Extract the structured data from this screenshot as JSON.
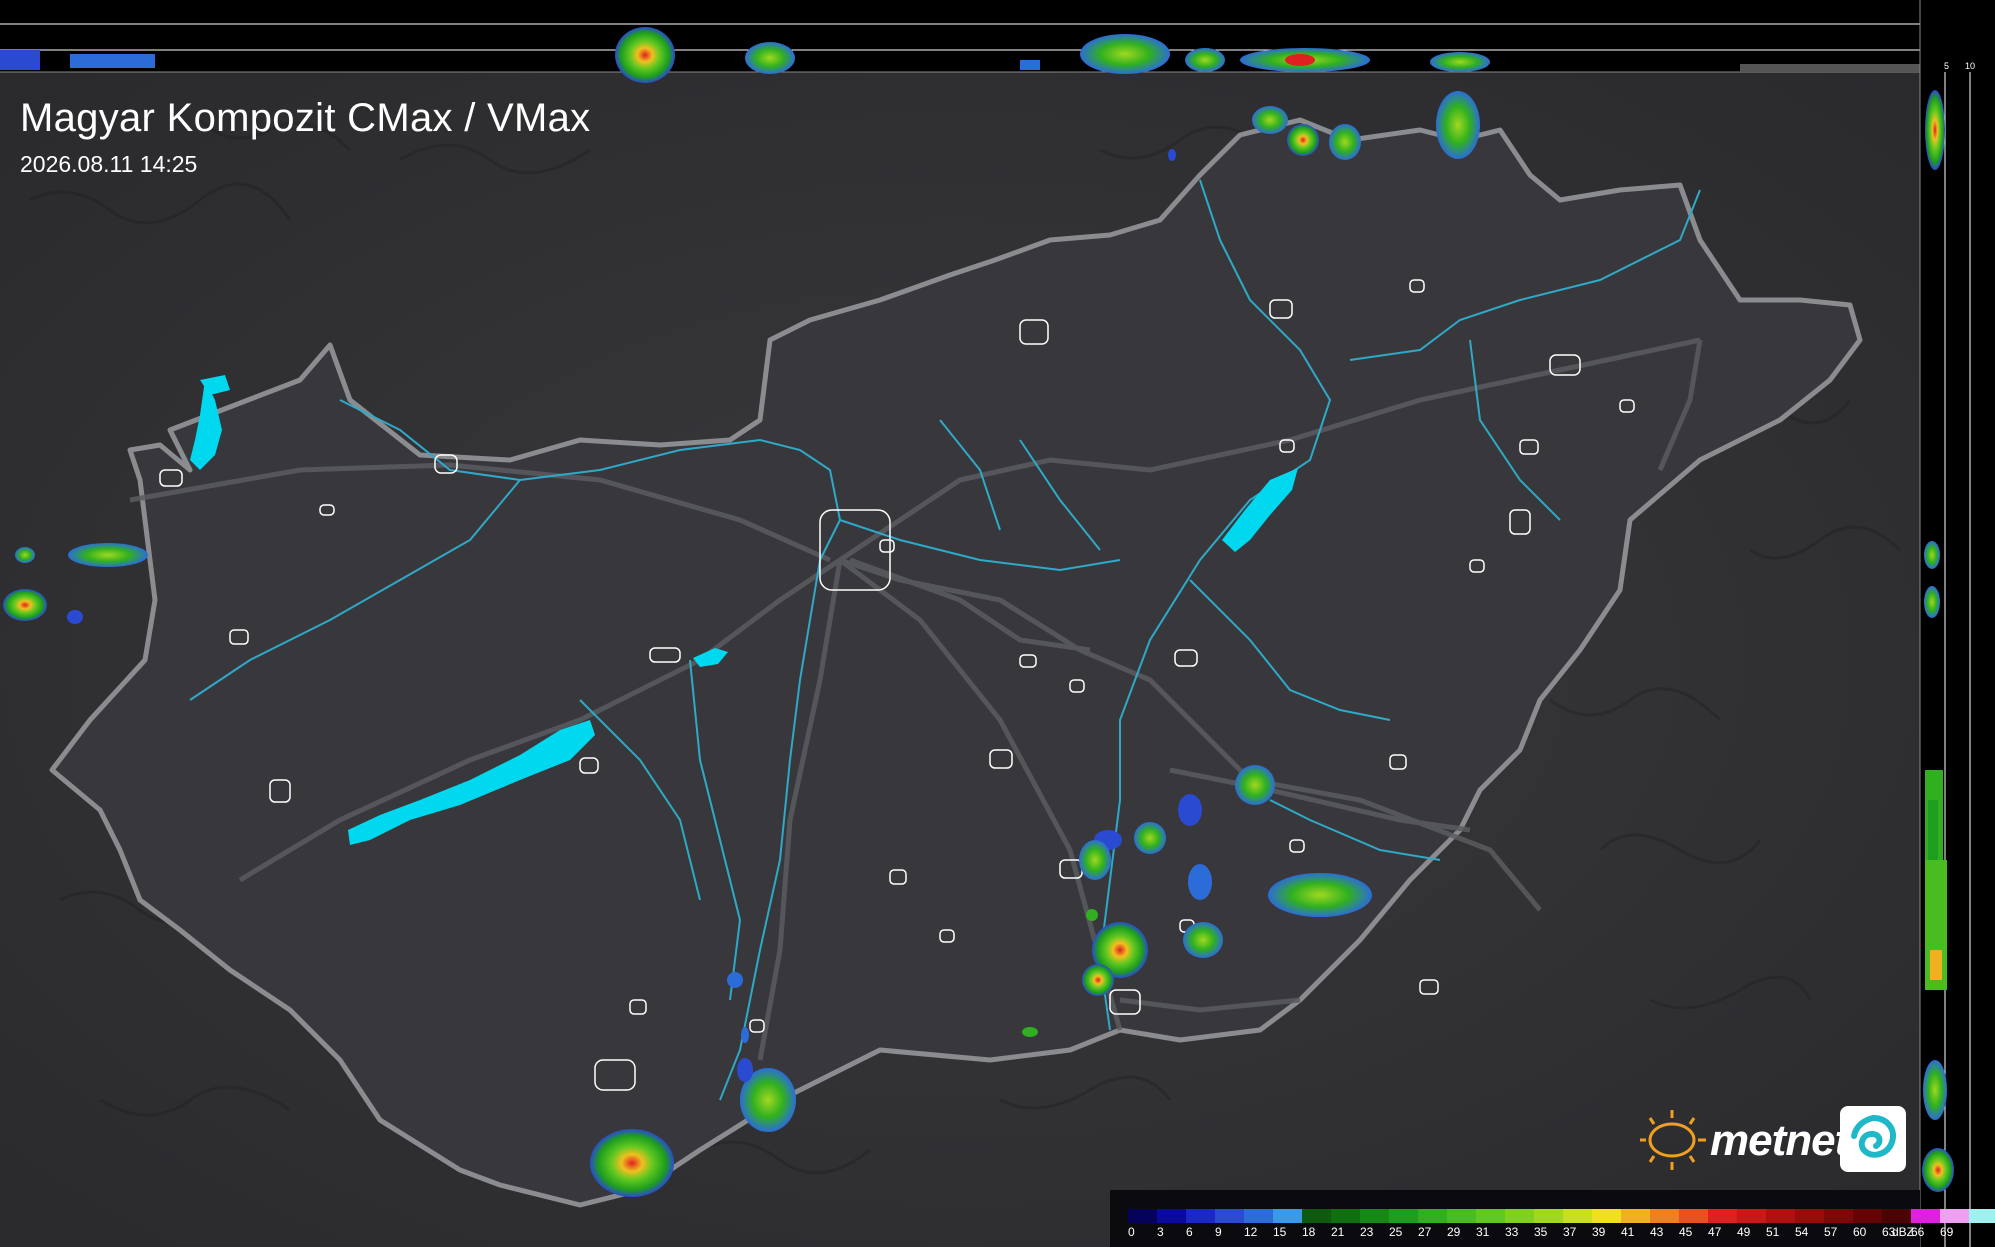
{
  "header": {
    "title": "Magyar Kompozit CMax / VMax",
    "timestamp": "2026.08.11 14:25"
  },
  "profile_scale": {
    "top_labels": [
      "10",
      "5"
    ],
    "side_labels": [
      "5",
      "10"
    ]
  },
  "legend": {
    "unit": "dBZ",
    "steps": [
      {
        "label": "0",
        "color": "#04025a"
      },
      {
        "label": "3",
        "color": "#0a0aa0"
      },
      {
        "label": "6",
        "color": "#1a28c8"
      },
      {
        "label": "9",
        "color": "#2a4ad2"
      },
      {
        "label": "12",
        "color": "#2c6cd8"
      },
      {
        "label": "15",
        "color": "#3a9ae8"
      },
      {
        "label": "18",
        "color": "#0e5a10"
      },
      {
        "label": "21",
        "color": "#107010"
      },
      {
        "label": "23",
        "color": "#168816"
      },
      {
        "label": "25",
        "color": "#1e9e1e"
      },
      {
        "label": "27",
        "color": "#30b020"
      },
      {
        "label": "29",
        "color": "#48bc20"
      },
      {
        "label": "31",
        "color": "#60c820"
      },
      {
        "label": "33",
        "color": "#80d020"
      },
      {
        "label": "35",
        "color": "#a0d820"
      },
      {
        "label": "37",
        "color": "#c8e020"
      },
      {
        "label": "39",
        "color": "#f0e020"
      },
      {
        "label": "41",
        "color": "#f0b020"
      },
      {
        "label": "43",
        "color": "#ee8020"
      },
      {
        "label": "45",
        "color": "#e85020"
      },
      {
        "label": "47",
        "color": "#e02020"
      },
      {
        "label": "49",
        "color": "#c81818"
      },
      {
        "label": "51",
        "color": "#b01010"
      },
      {
        "label": "54",
        "color": "#980c0c"
      },
      {
        "label": "57",
        "color": "#7e0808"
      },
      {
        "label": "60",
        "color": "#640404"
      },
      {
        "label": "63",
        "color": "#4a0202"
      },
      {
        "label": "66",
        "color": "#e020e0"
      },
      {
        "label": "69",
        "color": "#f0a0f0"
      },
      {
        "label": "",
        "color": "#a0f0f0"
      }
    ]
  },
  "brand": {
    "name": "metnet"
  },
  "map": {
    "lake_color": "#00d8f0",
    "river_color": "#2fa9c8",
    "border_color": "#8a8c90",
    "country_fill": "#3a3a3e"
  }
}
